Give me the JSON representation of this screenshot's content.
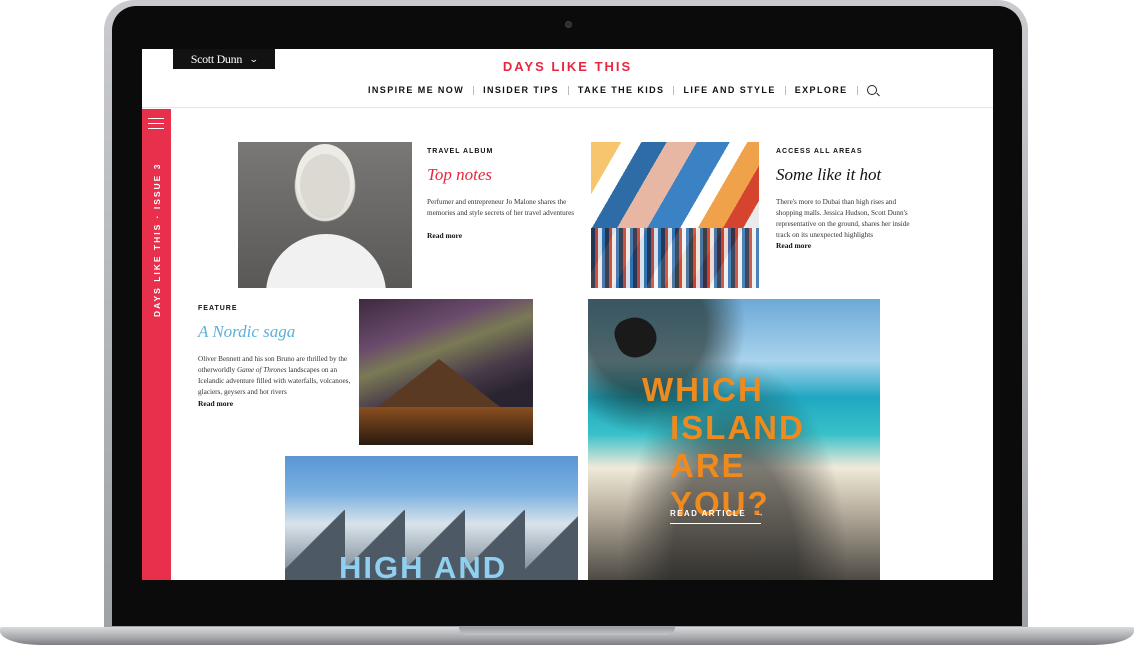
{
  "brand": {
    "logo": "Scott Dunn",
    "chevron_icon": "chevron-down-icon"
  },
  "site": {
    "title": "DAYS LIKE THIS",
    "accent": "#e8273f",
    "sidebar_color": "#e8304c"
  },
  "nav": {
    "items": [
      "INSPIRE ME NOW",
      "INSIDER TIPS",
      "TAKE THE KIDS",
      "LIFE AND STYLE",
      "EXPLORE"
    ],
    "search_icon": "search-icon"
  },
  "sidebar": {
    "menu_icon": "hamburger-icon",
    "label": "DAYS LIKE THIS · ISSUE 3"
  },
  "articles": [
    {
      "kicker": "TRAVEL ALBUM",
      "headline": "Top notes",
      "headline_color": "#e8273f",
      "body": "Perfumer and entrepreneur Jo Malone shares the memories and style secrets of her travel adventures",
      "read_more": "Read more"
    },
    {
      "kicker": "ACCESS ALL AREAS",
      "headline": "Some like it hot",
      "headline_color": "#111111",
      "body": "There's more to Dubai than high rises and shopping malls. Jessica Hudson, Scott Dunn's representative on the ground, shares her inside track on its unexpected highlights",
      "read_more": "Read more"
    },
    {
      "kicker": "FEATURE",
      "headline": "A Nordic saga",
      "headline_color": "#5bb0d6",
      "body_before": "Oliver Bennett and his son Bruno are thrilled by the otherworldly ",
      "body_italic": "Game of Thrones",
      "body_after": " landscapes on an Icelandic adventure filled with waterfalls, volcanoes, glaciers, geysers and hot rivers",
      "read_more": "Read more"
    }
  ],
  "feature_island": {
    "title_lines": [
      "WHICH",
      "ISLAND ARE",
      "YOU?"
    ],
    "cta": "READ ARTICLE",
    "arrow": "→",
    "title_color": "#ef8a1f"
  },
  "feature_mountain": {
    "title": "HIGH AND"
  }
}
